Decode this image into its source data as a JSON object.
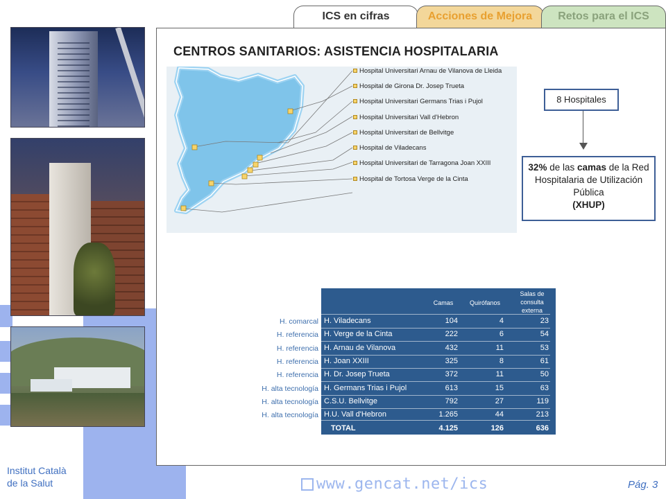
{
  "tabs": [
    {
      "label": "ICS en cifras"
    },
    {
      "label": "Acciones de Mejora"
    },
    {
      "label": "Retos para el ICS"
    }
  ],
  "heading": "CENTROS SANITARIOS: ASISTENCIA HOSPITALARIA",
  "map": {
    "hospitals": [
      "Hospital Universitari Arnau de Vilanova de Lleida",
      "Hospital de Girona Dr. Josep Trueta",
      "Hospital Universitari Germans Trias i Pujol",
      "Hospital Universitari Vall d'Hebron",
      "Hospital Universitari de Bellvitge",
      "Hospital de Viladecans",
      "Hospital Universitari de Tarragona Joan XXIII",
      "Hospital de Tortosa Verge de la Cinta"
    ]
  },
  "callout_count": "8 Hospitales",
  "callout_share": {
    "pct": "32%",
    "text1": " de las ",
    "bold": "camas",
    "text2": " de la Red Hospitalaria de Utilización Pública",
    "abbr": "(XHUP)"
  },
  "table": {
    "headers": [
      "Camas",
      "Quirófanos",
      "Salas de consulta externa"
    ],
    "rows": [
      {
        "cat": "H. comarcal",
        "name": "H. Viladecans",
        "camas": "104",
        "quir": "4",
        "salas": "23"
      },
      {
        "cat": "H. referencia",
        "name": "H. Verge de la Cinta",
        "camas": "222",
        "quir": "6",
        "salas": "54"
      },
      {
        "cat": "H. referencia",
        "name": "H. Arnau de Vilanova",
        "camas": "432",
        "quir": "11",
        "salas": "53"
      },
      {
        "cat": "H. referencia",
        "name": "H. Joan XXIII",
        "camas": "325",
        "quir": "8",
        "salas": "61"
      },
      {
        "cat": "H. referencia",
        "name": "H. Dr. Josep Trueta",
        "camas": "372",
        "quir": "11",
        "salas": "50"
      },
      {
        "cat": "H. alta tecnología",
        "name": "H. Germans Trias i Pujol",
        "camas": "613",
        "quir": "15",
        "salas": "63"
      },
      {
        "cat": "H. alta tecnología",
        "name": "C.S.U. Bellvitge",
        "camas": "792",
        "quir": "27",
        "salas": "119"
      },
      {
        "cat": "H. alta tecnología",
        "name": "H.U. Vall d'Hebron",
        "camas": "1.265",
        "quir": "44",
        "salas": "213"
      }
    ],
    "total": {
      "name": "TOTAL",
      "camas": "4.125",
      "quir": "126",
      "salas": "636"
    }
  },
  "footer": {
    "org_line1": "Institut Català",
    "org_line2": "de la Salut",
    "url": "www.gencat.net/ics",
    "page": "Pág. 3"
  },
  "colors": {
    "table_bg": "#2d5b8e",
    "callout_border": "#3d5e96",
    "deco_blue": "#9db3ee",
    "map_region": "#7fc4ea"
  }
}
